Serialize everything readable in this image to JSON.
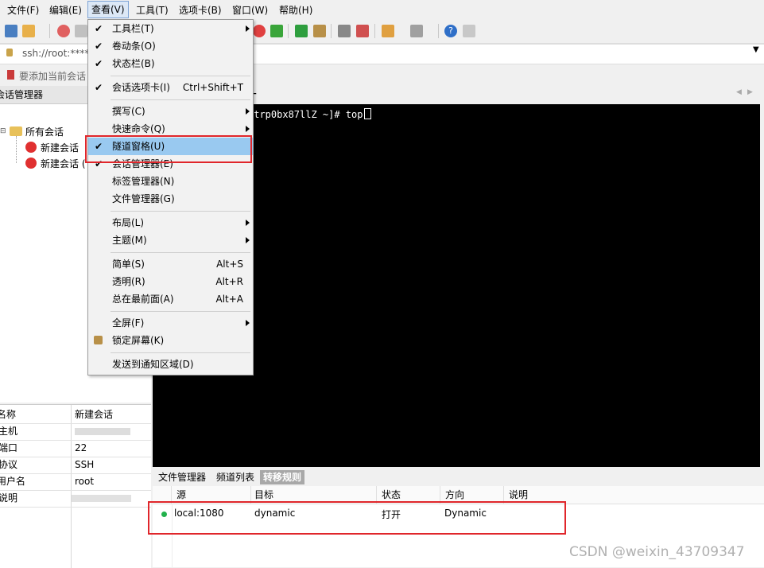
{
  "menubar": {
    "items": [
      "文件(F)",
      "编辑(E)",
      "查看(V)",
      "工具(T)",
      "选项卡(B)",
      "窗口(W)",
      "帮助(H)"
    ],
    "active": "查看(V)"
  },
  "address": {
    "text": "ssh://root:*****"
  },
  "bookmark": {
    "text": "要添加当前会话"
  },
  "session_manager": {
    "header": "会话管理器",
    "tree": {
      "root": "所有会话",
      "children": [
        "新建会话",
        "新建会话 ("
      ]
    }
  },
  "properties": {
    "rows": [
      {
        "key": "名称",
        "value": "新建会话"
      },
      {
        "key": "主机",
        "value": ""
      },
      {
        "key": "端口",
        "value": "22"
      },
      {
        "key": "协议",
        "value": "SSH"
      },
      {
        "key": "用户名",
        "value": "root"
      },
      {
        "key": "说明",
        "value": ""
      }
    ]
  },
  "terminal": {
    "prompt": "ltrp0bx87llZ ~]# top",
    "tab_add": "+"
  },
  "bottom_tabs": [
    "文件管理器",
    "频道列表",
    "转移规则"
  ],
  "bottom_active": "转移规则",
  "tunnel_table": {
    "headers": [
      "源",
      "目标",
      "状态",
      "方向",
      "说明"
    ],
    "rows": [
      {
        "source": "local:1080",
        "target": "dynamic",
        "status": "打开",
        "direction": "Dynamic",
        "note": ""
      }
    ],
    "status_color": "#22b14c"
  },
  "view_menu": {
    "items": [
      {
        "label": "工具栏(T)",
        "checked": true,
        "submenu": true
      },
      {
        "label": "卷动条(O)",
        "checked": true
      },
      {
        "label": "状态栏(B)",
        "checked": true
      },
      {
        "sep": true
      },
      {
        "label": "会话选项卡(I)",
        "checked": true,
        "shortcut": "Ctrl+Shift+T"
      },
      {
        "sep": true
      },
      {
        "label": "撰写(C)",
        "submenu": true
      },
      {
        "label": "快速命令(Q)",
        "submenu": true
      },
      {
        "label": "隧道窗格(U)",
        "checked": true,
        "highlighted": true
      },
      {
        "label": "会话管理器(E)",
        "checked": true
      },
      {
        "label": "标签管理器(N)"
      },
      {
        "label": "文件管理器(G)"
      },
      {
        "sep": true
      },
      {
        "label": "布局(L)",
        "submenu": true
      },
      {
        "label": "主题(M)",
        "submenu": true
      },
      {
        "sep": true
      },
      {
        "label": "简单(S)",
        "shortcut": "Alt+S"
      },
      {
        "label": "透明(R)",
        "shortcut": "Alt+R"
      },
      {
        "label": "总在最前面(A)",
        "shortcut": "Alt+A"
      },
      {
        "sep": true
      },
      {
        "label": "全屏(F)",
        "submenu": true
      },
      {
        "label": "锁定屏幕(K)",
        "icon": "lock-icon"
      },
      {
        "sep": true
      },
      {
        "label": "发送到通知区域(D)"
      }
    ]
  },
  "watermark": "CSDN @weixin_43709347",
  "colors": {
    "highlight": "#99c9f0",
    "annotation_red": "#e0262b",
    "terminal_bg": "#000000"
  }
}
